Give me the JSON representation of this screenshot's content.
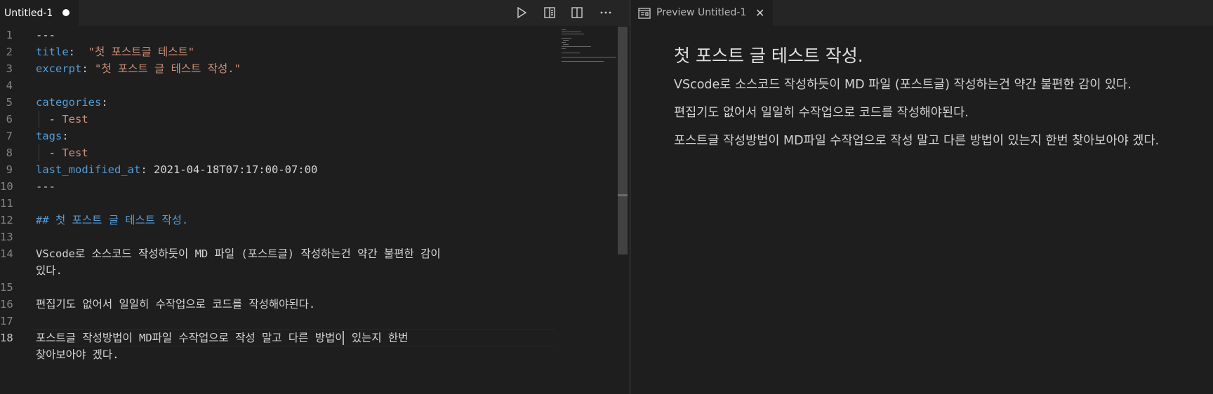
{
  "editor": {
    "tab": {
      "title": "Untitled-1"
    },
    "lines": [
      {
        "n": "1",
        "segs": [
          {
            "t": "---",
            "c": "plain"
          }
        ]
      },
      {
        "n": "2",
        "segs": [
          {
            "t": "title",
            "c": "key"
          },
          {
            "t": ":  ",
            "c": "punc"
          },
          {
            "t": "\"첫 포스트글 테스트\"",
            "c": "str"
          }
        ]
      },
      {
        "n": "3",
        "segs": [
          {
            "t": "excerpt",
            "c": "key"
          },
          {
            "t": ": ",
            "c": "punc"
          },
          {
            "t": "\"첫 포스트 글 테스트 작성.\"",
            "c": "str"
          }
        ]
      },
      {
        "n": "4",
        "segs": []
      },
      {
        "n": "5",
        "segs": [
          {
            "t": "categories",
            "c": "key"
          },
          {
            "t": ":",
            "c": "punc"
          }
        ]
      },
      {
        "n": "6",
        "segs": [
          {
            "t": "  - ",
            "c": "punc"
          },
          {
            "t": "Test",
            "c": "str"
          }
        ]
      },
      {
        "n": "7",
        "segs": [
          {
            "t": "tags",
            "c": "key"
          },
          {
            "t": ":",
            "c": "punc"
          }
        ]
      },
      {
        "n": "8",
        "segs": [
          {
            "t": "  - ",
            "c": "punc"
          },
          {
            "t": "Test",
            "c": "str"
          }
        ]
      },
      {
        "n": "9",
        "segs": [
          {
            "t": "last_modified_at",
            "c": "key"
          },
          {
            "t": ": ",
            "c": "punc"
          },
          {
            "t": "2021-04-18T07:17:00-07:00",
            "c": "plain"
          }
        ]
      },
      {
        "n": "10",
        "segs": [
          {
            "t": "---",
            "c": "plain"
          }
        ]
      },
      {
        "n": "11",
        "segs": []
      },
      {
        "n": "12",
        "segs": [
          {
            "t": "## 첫 포스트 글 테스트 작성.",
            "c": "heading"
          }
        ]
      },
      {
        "n": "13",
        "segs": []
      },
      {
        "n": "14",
        "segs": [
          {
            "t": "VScode로 소스코드 작성하듯이 MD 파일 (포스트글) 작성하는건 약간 불편한 감이",
            "c": "plain"
          }
        ]
      },
      {
        "n": "",
        "segs": [
          {
            "t": "있다.",
            "c": "plain"
          }
        ]
      },
      {
        "n": "15",
        "segs": []
      },
      {
        "n": "16",
        "segs": [
          {
            "t": "편집기도 없어서 일일히 수작업으로 코드를 작성해야된다.",
            "c": "plain"
          }
        ]
      },
      {
        "n": "17",
        "segs": []
      },
      {
        "n": "18",
        "segs": [
          {
            "t": "포스트글 작성방법이 MD파일 수작업으로 작성 말고 다른 방법이 있는지 한번",
            "c": "plain"
          }
        ],
        "active": true
      },
      {
        "n": "",
        "segs": [
          {
            "t": "찾아보아야 겠다.",
            "c": "plain"
          }
        ]
      }
    ]
  },
  "preview": {
    "tab": {
      "title": "Preview Untitled-1",
      "close": "✕"
    },
    "heading": "첫 포스트 글 테스트 작성.",
    "paragraphs": [
      "VScode로 소스코드 작성하듯이 MD 파일 (포스트글) 작성하는건 약간 불편한 감이 있다.",
      "편집기도 없어서 일일히 수작업으로 코드를 작성해야된다.",
      "포스트글 작성방법이 MD파일 수작업으로 작성 말고 다른 방법이 있는지 한번 찾아보아야 겠다."
    ]
  },
  "icons": [
    "run-icon",
    "open-preview-icon",
    "split-editor-icon",
    "more-actions-icon",
    "preview-icon",
    "close-icon"
  ],
  "colors": {
    "background": "#1e1e1e",
    "tabbar": "#252526",
    "yaml_key": "#569cd6",
    "string": "#ce9178",
    "text": "#d4d4d4"
  }
}
